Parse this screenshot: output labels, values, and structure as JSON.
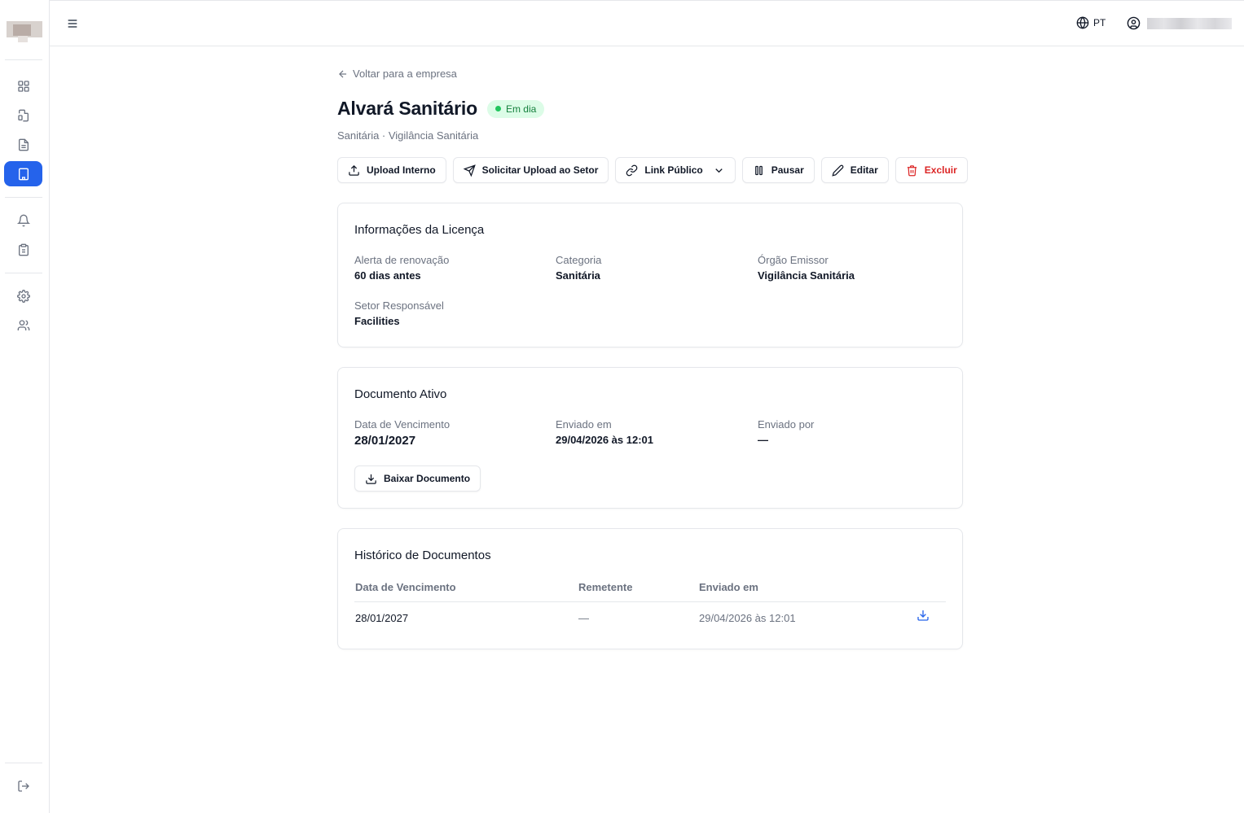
{
  "sidebar": {
    "items": [
      {
        "icon": "dashboard-grid-icon"
      },
      {
        "icon": "document-link-icon"
      },
      {
        "icon": "file-text-icon"
      },
      {
        "icon": "building-icon",
        "active": true
      },
      {
        "icon": "bell-icon"
      },
      {
        "icon": "clipboard-icon"
      },
      {
        "icon": "gear-icon"
      },
      {
        "icon": "users-icon"
      },
      {
        "icon": "logout-icon"
      }
    ]
  },
  "header": {
    "language": "PT"
  },
  "page": {
    "back_label": "Voltar para a empresa",
    "title": "Alvará Sanitário",
    "status": "Em dia",
    "subtitle": "Sanitária · Vigilância Sanitária",
    "actions": {
      "upload_internal": "Upload Interno",
      "request_upload": "Solicitar Upload ao Setor",
      "public_link": "Link Público",
      "pause": "Pausar",
      "edit": "Editar",
      "delete": "Excluir"
    }
  },
  "license_info": {
    "title": "Informações da Licença",
    "renewal_alert_label": "Alerta de renovação",
    "renewal_alert_value": "60 dias antes",
    "category_label": "Categoria",
    "category_value": "Sanitária",
    "issuer_label": "Órgão Emissor",
    "issuer_value": "Vigilância Sanitária",
    "sector_label": "Setor Responsável",
    "sector_value": "Facilities"
  },
  "active_document": {
    "title": "Documento Ativo",
    "due_label": "Data de Vencimento",
    "due_value": "28/01/2027",
    "sent_at_label": "Enviado em",
    "sent_at_value": "29/04/2026 às 12:01",
    "sent_by_label": "Enviado por",
    "sent_by_value": "—",
    "download_label": "Baixar Documento"
  },
  "history": {
    "title": "Histórico de Documentos",
    "columns": [
      "Data de Vencimento",
      "Remetente",
      "Enviado em"
    ],
    "rows": [
      {
        "due": "28/01/2027",
        "sender": "—",
        "sent_at": "29/04/2026 às 12:01"
      }
    ]
  },
  "colors": {
    "accent": "#2563eb",
    "status_bg": "#dcfce7",
    "status_text": "#15803d",
    "danger": "#dc2626"
  }
}
